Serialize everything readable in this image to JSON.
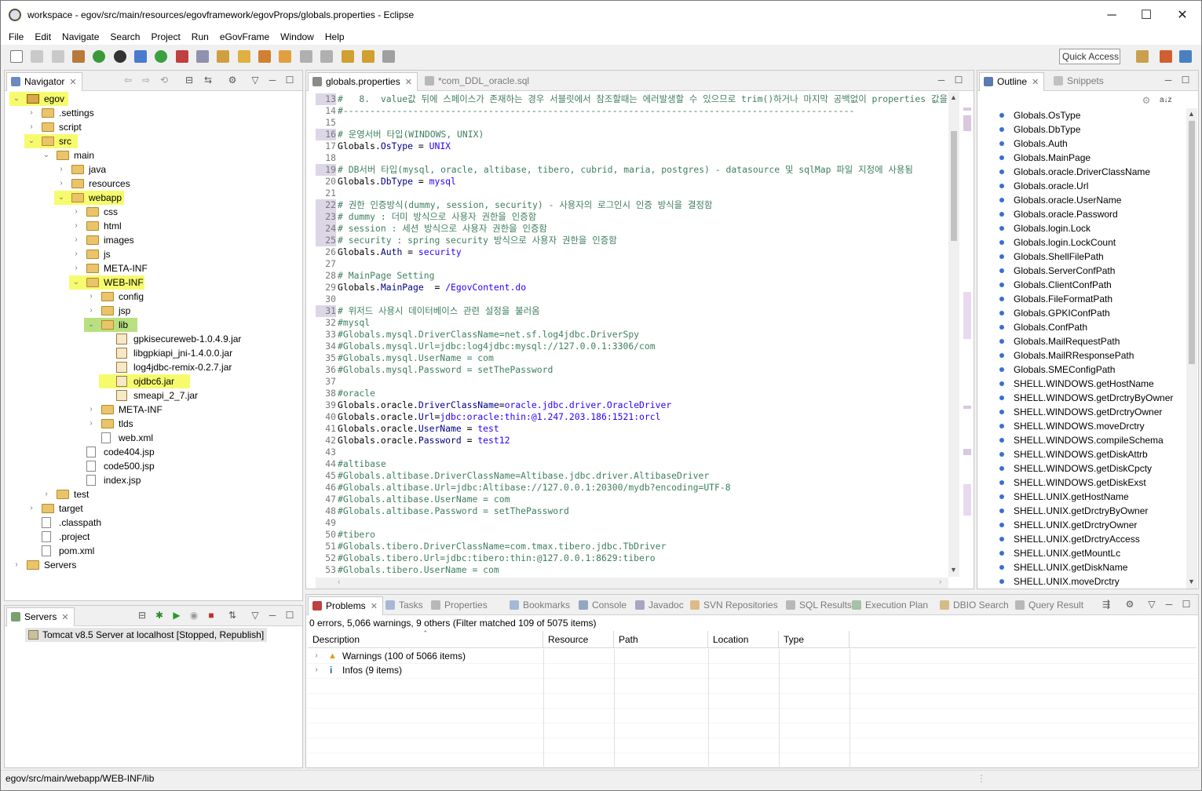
{
  "window": {
    "title": "workspace - egov/src/main/resources/egovframework/egovProps/globals.properties - Eclipse",
    "minimize": "─",
    "maximize": "☐",
    "close": "✕"
  },
  "menu": [
    "File",
    "Edit",
    "Navigate",
    "Search",
    "Project",
    "Run",
    "eGovFrame",
    "Window",
    "Help"
  ],
  "toolbar": {
    "quick_access": "Quick Access"
  },
  "navigator": {
    "tab": "Navigator",
    "tree": [
      {
        "label": "egov",
        "depth": 0,
        "kind": "project",
        "open": true
      },
      {
        "label": ".settings",
        "depth": 1,
        "kind": "folder",
        "open": false
      },
      {
        "label": "script",
        "depth": 1,
        "kind": "folder",
        "open": false
      },
      {
        "label": "src",
        "depth": 1,
        "kind": "folder",
        "open": true
      },
      {
        "label": "main",
        "depth": 2,
        "kind": "folder",
        "open": true
      },
      {
        "label": "java",
        "depth": 3,
        "kind": "folder",
        "open": false
      },
      {
        "label": "resources",
        "depth": 3,
        "kind": "folder",
        "open": false
      },
      {
        "label": "webapp",
        "depth": 3,
        "kind": "folder",
        "open": true
      },
      {
        "label": "css",
        "depth": 4,
        "kind": "folder",
        "open": false
      },
      {
        "label": "html",
        "depth": 4,
        "kind": "folder",
        "open": false
      },
      {
        "label": "images",
        "depth": 4,
        "kind": "folder",
        "open": false
      },
      {
        "label": "js",
        "depth": 4,
        "kind": "folder",
        "open": false
      },
      {
        "label": "META-INF",
        "depth": 4,
        "kind": "folder",
        "open": false
      },
      {
        "label": "WEB-INF",
        "depth": 4,
        "kind": "folder",
        "open": true
      },
      {
        "label": "config",
        "depth": 5,
        "kind": "folder",
        "open": false
      },
      {
        "label": "jsp",
        "depth": 5,
        "kind": "folder",
        "open": false
      },
      {
        "label": "lib",
        "depth": 5,
        "kind": "folder",
        "open": true
      },
      {
        "label": "gpkisecureweb-1.0.4.9.jar",
        "depth": 6,
        "kind": "jar"
      },
      {
        "label": "libgpkiapi_jni-1.4.0.0.jar",
        "depth": 6,
        "kind": "jar"
      },
      {
        "label": "log4jdbc-remix-0.2.7.jar",
        "depth": 6,
        "kind": "jar"
      },
      {
        "label": "ojdbc6.jar",
        "depth": 6,
        "kind": "jar"
      },
      {
        "label": "smeapi_2_7.jar",
        "depth": 6,
        "kind": "jar"
      },
      {
        "label": "META-INF",
        "depth": 5,
        "kind": "folder",
        "open": false
      },
      {
        "label": "tlds",
        "depth": 5,
        "kind": "folder",
        "open": false
      },
      {
        "label": "web.xml",
        "depth": 5,
        "kind": "file"
      },
      {
        "label": "code404.jsp",
        "depth": 4,
        "kind": "file"
      },
      {
        "label": "code500.jsp",
        "depth": 4,
        "kind": "file"
      },
      {
        "label": "index.jsp",
        "depth": 4,
        "kind": "file"
      },
      {
        "label": "test",
        "depth": 2,
        "kind": "folder",
        "open": false
      },
      {
        "label": "target",
        "depth": 1,
        "kind": "folder",
        "open": false
      },
      {
        "label": ".classpath",
        "depth": 1,
        "kind": "file"
      },
      {
        "label": ".project",
        "depth": 1,
        "kind": "file"
      },
      {
        "label": "pom.xml",
        "depth": 1,
        "kind": "file"
      },
      {
        "label": "Servers",
        "depth": 0,
        "kind": "folder",
        "open": false
      }
    ],
    "highlighted": [
      "egov",
      "src",
      "webapp",
      "WEB-INF",
      "lib",
      "ojdbc6.jar"
    ],
    "selected": "lib"
  },
  "servers": {
    "tab": "Servers",
    "entry": "Tomcat v8.5 Server at localhost  [Stopped, Republish]"
  },
  "editor": {
    "tabs": [
      "globals.properties",
      "*com_DDL_oracle.sql"
    ],
    "lines": [
      {
        "n": "13",
        "t": "#   8.  value값 뒤에 스페이스가 존재하는 경우 서블릿에서 참조할때는 에러발생할 수 있으므로 trim()하거나 마지막 공백없이 properties 값을 설정할것",
        "k": "cm",
        "h": true
      },
      {
        "n": "14",
        "t": "#-----------------------------------------------------------------------------------------------",
        "k": "cm"
      },
      {
        "n": "15",
        "t": "",
        "k": "cm"
      },
      {
        "n": "16",
        "t": "# 운영서버 타입(WINDOWS, UNIX)",
        "k": "cm",
        "h": true
      },
      {
        "n": "17",
        "t": "Globals.OsType = UNIX",
        "k": "kv"
      },
      {
        "n": "18",
        "t": "",
        "k": "cm"
      },
      {
        "n": "19",
        "t": "# DB서버 타입(mysql, oracle, altibase, tibero, cubrid, maria, postgres) - datasource 및 sqlMap 파일 지정에 사용됨",
        "k": "cm",
        "h": true
      },
      {
        "n": "20",
        "t": "Globals.DbType = mysql",
        "k": "kv"
      },
      {
        "n": "21",
        "t": "",
        "k": "cm"
      },
      {
        "n": "22",
        "t": "# 권한 인증방식(dummy, session, security) - 사용자의 로그인시 인증 방식을 결정함",
        "k": "cm",
        "h": true
      },
      {
        "n": "23",
        "t": "# dummy : 더미 방식으로 사용자 권한을 인증함",
        "k": "cm",
        "h": true
      },
      {
        "n": "24",
        "t": "# session : 세션 방식으로 사용자 권한을 인증함",
        "k": "cm",
        "h": true
      },
      {
        "n": "25",
        "t": "# security : spring security 방식으로 사용자 권한을 인증함",
        "k": "cm",
        "h": true
      },
      {
        "n": "26",
        "t": "Globals.Auth = security",
        "k": "kv"
      },
      {
        "n": "27",
        "t": "",
        "k": "cm"
      },
      {
        "n": "28",
        "t": "# MainPage Setting",
        "k": "cm"
      },
      {
        "n": "29",
        "t": "Globals.MainPage  = /EgovContent.do",
        "k": "kv"
      },
      {
        "n": "30",
        "t": "",
        "k": "cm"
      },
      {
        "n": "31",
        "t": "# 위저드 사용시 데이터베이스 관련 설정을 불러옴",
        "k": "cm",
        "h": true
      },
      {
        "n": "32",
        "t": "#mysql",
        "k": "cm"
      },
      {
        "n": "33",
        "t": "#Globals.mysql.DriverClassName=net.sf.log4jdbc.DriverSpy",
        "k": "cm"
      },
      {
        "n": "34",
        "t": "#Globals.mysql.Url=jdbc:log4jdbc:mysql://127.0.0.1:3306/com",
        "k": "cm"
      },
      {
        "n": "35",
        "t": "#Globals.mysql.UserName = com",
        "k": "cm"
      },
      {
        "n": "36",
        "t": "#Globals.mysql.Password = setThePassword",
        "k": "cm"
      },
      {
        "n": "37",
        "t": "",
        "k": "cm"
      },
      {
        "n": "38",
        "t": "#oracle",
        "k": "cm"
      },
      {
        "n": "39",
        "t": "Globals.oracle.DriverClassName=oracle.jdbc.driver.OracleDriver",
        "k": "kv"
      },
      {
        "n": "40",
        "t": "Globals.oracle.Url=jdbc:oracle:thin:@1.247.203.186:1521:orcl",
        "k": "kv"
      },
      {
        "n": "41",
        "t": "Globals.oracle.UserName = test",
        "k": "kv"
      },
      {
        "n": "42",
        "t": "Globals.oracle.Password = test12",
        "k": "kv"
      },
      {
        "n": "43",
        "t": "",
        "k": "cm"
      },
      {
        "n": "44",
        "t": "#altibase",
        "k": "cm"
      },
      {
        "n": "45",
        "t": "#Globals.altibase.DriverClassName=Altibase.jdbc.driver.AltibaseDriver",
        "k": "cm"
      },
      {
        "n": "46",
        "t": "#Globals.altibase.Url=jdbc:Altibase://127.0.0.1:20300/mydb?encoding=UTF-8",
        "k": "cm"
      },
      {
        "n": "47",
        "t": "#Globals.altibase.UserName = com",
        "k": "cm"
      },
      {
        "n": "48",
        "t": "#Globals.altibase.Password = setThePassword",
        "k": "cm"
      },
      {
        "n": "49",
        "t": "",
        "k": "cm"
      },
      {
        "n": "50",
        "t": "#tibero",
        "k": "cm"
      },
      {
        "n": "51",
        "t": "#Globals.tibero.DriverClassName=com.tmax.tibero.jdbc.TbDriver",
        "k": "cm"
      },
      {
        "n": "52",
        "t": "#Globals.tibero.Url=jdbc:tibero:thin:@127.0.0.1:8629:tibero",
        "k": "cm"
      },
      {
        "n": "53",
        "t": "#Globals.tibero.UserName = com",
        "k": "cm"
      }
    ]
  },
  "outline": {
    "tabs": [
      "Outline",
      "Snippets"
    ],
    "items": [
      "Globals.OsType",
      "Globals.DbType",
      "Globals.Auth",
      "Globals.MainPage",
      "Globals.oracle.DriverClassName",
      "Globals.oracle.Url",
      "Globals.oracle.UserName",
      "Globals.oracle.Password",
      "Globals.login.Lock",
      "Globals.login.LockCount",
      "Globals.ShellFilePath",
      "Globals.ServerConfPath",
      "Globals.ClientConfPath",
      "Globals.FileFormatPath",
      "Globals.GPKIConfPath",
      "Globals.ConfPath",
      "Globals.MailRequestPath",
      "Globals.MailRResponsePath",
      "Globals.SMEConfigPath",
      "SHELL.WINDOWS.getHostName",
      "SHELL.WINDOWS.getDrctryByOwner",
      "SHELL.WINDOWS.getDrctryOwner",
      "SHELL.WINDOWS.moveDrctry",
      "SHELL.WINDOWS.compileSchema",
      "SHELL.WINDOWS.getDiskAttrb",
      "SHELL.WINDOWS.getDiskCpcty",
      "SHELL.WINDOWS.getDiskExst",
      "SHELL.UNIX.getHostName",
      "SHELL.UNIX.getDrctryByOwner",
      "SHELL.UNIX.getDrctryOwner",
      "SHELL.UNIX.getDrctryAccess",
      "SHELL.UNIX.getMountLc",
      "SHELL.UNIX.getDiskName",
      "SHELL.UNIX.moveDrctry"
    ]
  },
  "bottom": {
    "tabs": [
      "Problems",
      "Tasks",
      "Properties",
      "Bookmarks",
      "Console",
      "Javadoc",
      "SVN Repositories",
      "SQL Results",
      "Execution Plan",
      "DBIO Search",
      "Query Result"
    ],
    "summary": "0 errors, 5,066 warnings, 9 others (Filter matched 109 of 5075 items)",
    "columns": [
      "Description",
      "Resource",
      "Path",
      "Location",
      "Type"
    ],
    "rows": [
      "Warnings (100 of 5066 items)",
      "Infos (9 items)"
    ]
  },
  "status": {
    "path": "egov/src/main/webapp/WEB-INF/lib"
  },
  "colors": {
    "highlight": "#f6fb6e",
    "selection": "#b9e080",
    "comment": "#3f7f5f",
    "key": "#000080",
    "value": "#2a00ff"
  }
}
